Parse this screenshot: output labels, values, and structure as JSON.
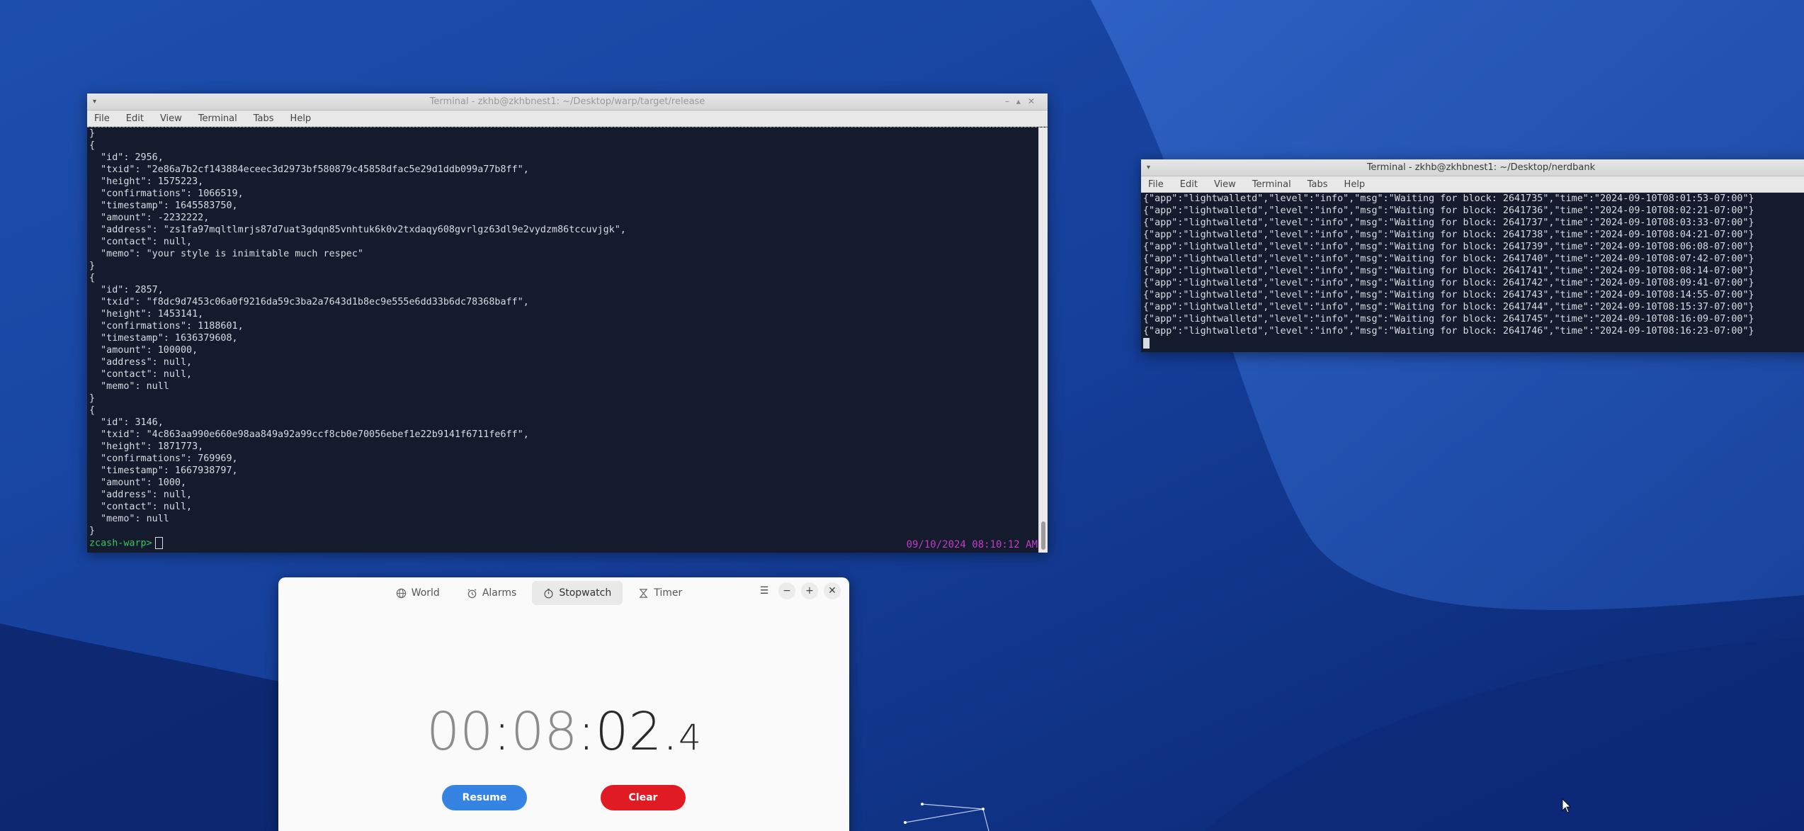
{
  "terminal1": {
    "title": "Terminal - zkhb@zkhbnest1: ~/Desktop/warp/target/release",
    "menu": [
      "File",
      "Edit",
      "View",
      "Terminal",
      "Tabs",
      "Help"
    ],
    "lines": [
      "}",
      "{",
      "  \"id\": 2956,",
      "  \"txid\": \"2e86a7b2cf143884eceec3d2973bf580879c45858dfac5e29d1ddb099a77b8ff\",",
      "  \"height\": 1575223,",
      "  \"confirmations\": 1066519,",
      "  \"timestamp\": 1645583750,",
      "  \"amount\": -2232222,",
      "  \"address\": \"zs1fa97mqltlmrjs87d7uat3gdqn85vnhtuk6k0v2txdaqy608gvrlgz63dl9e2vydzm86tccuvjgk\",",
      "  \"contact\": null,",
      "  \"memo\": \"your style is inimitable much respec\"",
      "}",
      "{",
      "  \"id\": 2857,",
      "  \"txid\": \"f8dc9d7453c06a0f9216da59c3ba2a7643d1b8ec9e555e6dd33b6dc78368baff\",",
      "  \"height\": 1453141,",
      "  \"confirmations\": 1188601,",
      "  \"timestamp\": 1636379608,",
      "  \"amount\": 100000,",
      "  \"address\": null,",
      "  \"contact\": null,",
      "  \"memo\": null",
      "}",
      "{",
      "  \"id\": 3146,",
      "  \"txid\": \"4c863aa990e660e98aa849a92a99ccf8cb0e70056ebef1e22b9141f6711fe6ff\",",
      "  \"height\": 1871773,",
      "  \"confirmations\": 769969,",
      "  \"timestamp\": 1667938797,",
      "  \"amount\": 1000,",
      "  \"address\": null,",
      "  \"contact\": null,",
      "  \"memo\": null",
      "}"
    ],
    "prompt": "zcash-warp>",
    "timestamp": "09/10/2024 08:10:12 AM"
  },
  "terminal2": {
    "title": "Terminal - zkhb@zkhbnest1: ~/Desktop/nerdbank",
    "menu": [
      "File",
      "Edit",
      "View",
      "Terminal",
      "Tabs",
      "Help"
    ],
    "lines": [
      "{\"app\":\"lightwalletd\",\"level\":\"info\",\"msg\":\"Waiting for block: 2641735\",\"time\":\"2024-09-10T08:01:53-07:00\"}",
      "{\"app\":\"lightwalletd\",\"level\":\"info\",\"msg\":\"Waiting for block: 2641736\",\"time\":\"2024-09-10T08:02:21-07:00\"}",
      "{\"app\":\"lightwalletd\",\"level\":\"info\",\"msg\":\"Waiting for block: 2641737\",\"time\":\"2024-09-10T08:03:33-07:00\"}",
      "{\"app\":\"lightwalletd\",\"level\":\"info\",\"msg\":\"Waiting for block: 2641738\",\"time\":\"2024-09-10T08:04:21-07:00\"}",
      "{\"app\":\"lightwalletd\",\"level\":\"info\",\"msg\":\"Waiting for block: 2641739\",\"time\":\"2024-09-10T08:06:08-07:00\"}",
      "{\"app\":\"lightwalletd\",\"level\":\"info\",\"msg\":\"Waiting for block: 2641740\",\"time\":\"2024-09-10T08:07:42-07:00\"}",
      "{\"app\":\"lightwalletd\",\"level\":\"info\",\"msg\":\"Waiting for block: 2641741\",\"time\":\"2024-09-10T08:08:14-07:00\"}",
      "{\"app\":\"lightwalletd\",\"level\":\"info\",\"msg\":\"Waiting for block: 2641742\",\"time\":\"2024-09-10T08:09:41-07:00\"}",
      "{\"app\":\"lightwalletd\",\"level\":\"info\",\"msg\":\"Waiting for block: 2641743\",\"time\":\"2024-09-10T08:14:55-07:00\"}",
      "{\"app\":\"lightwalletd\",\"level\":\"info\",\"msg\":\"Waiting for block: 2641744\",\"time\":\"2024-09-10T08:15:37-07:00\"}",
      "{\"app\":\"lightwalletd\",\"level\":\"info\",\"msg\":\"Waiting for block: 2641745\",\"time\":\"2024-09-10T08:16:09-07:00\"}",
      "{\"app\":\"lightwalletd\",\"level\":\"info\",\"msg\":\"Waiting for block: 2641746\",\"time\":\"2024-09-10T08:16:23-07:00\"}"
    ]
  },
  "clock": {
    "tabs": [
      "World",
      "Alarms",
      "Stopwatch",
      "Timer"
    ],
    "active_tab": "Stopwatch",
    "stopwatch": {
      "hours": "00",
      "minutes": "08",
      "seconds": "02",
      "tenths": "4"
    },
    "resume_label": "Resume",
    "clear_label": "Clear"
  },
  "colors": {
    "desktop_bg": "#0e2a7a",
    "terminal_bg": "#131b2c",
    "accent_blue": "#3584e4",
    "destructive_red": "#e01b24"
  }
}
